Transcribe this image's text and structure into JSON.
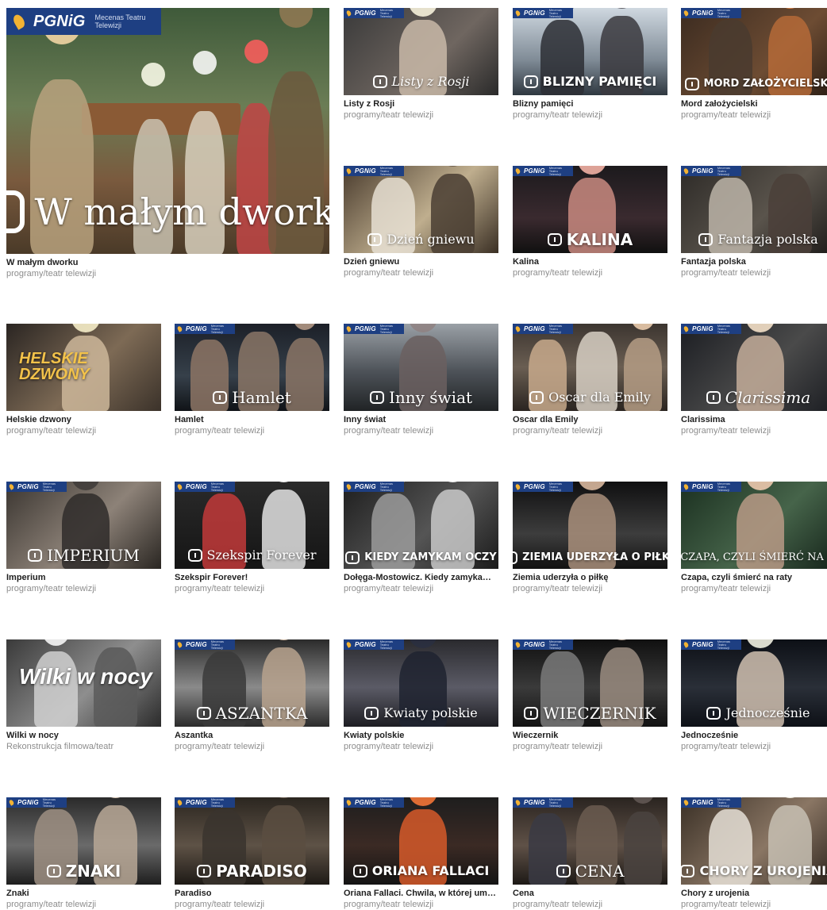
{
  "colors": {
    "title": "#1f1f1f",
    "subtitle": "#8d8d8d",
    "sponsor_band": "#1e3f82",
    "sponsor_flame": "#f2b233"
  },
  "sponsor": {
    "brand": "PGNiG",
    "mecenas": "Mecenas Teatru Telewizji"
  },
  "featured": {
    "title": "W małym dworku",
    "subtitle": "programy/teatr telewizji",
    "overlay": "W małym dworku"
  },
  "tiles": [
    {
      "title": "Listy z Rosji",
      "subtitle": "programy/teatr telewizji",
      "overlay": "Listy z Rosji"
    },
    {
      "title": "Blizny pamięci",
      "subtitle": "programy/teatr telewizji",
      "overlay": "BLIZNY PAMIĘCI"
    },
    {
      "title": "Mord założycielski",
      "subtitle": "programy/teatr telewizji",
      "overlay": "MORD ZAŁOŻYCIELSKI"
    },
    {
      "title": "Dzień gniewu",
      "subtitle": "programy/teatr telewizji",
      "overlay": "Dzień gniewu"
    },
    {
      "title": "Kalina",
      "subtitle": "programy/teatr telewizji",
      "overlay": "KALINA"
    },
    {
      "title": "Fantazja polska",
      "subtitle": "programy/teatr telewizji",
      "overlay": "Fantazja polska"
    },
    {
      "title": "Helskie dzwony",
      "subtitle": "programy/teatr telewizji",
      "overlay": "HELSKIE DZWONY"
    },
    {
      "title": "Hamlet",
      "subtitle": "programy/teatr telewizji",
      "overlay": "Hamlet"
    },
    {
      "title": "Inny świat",
      "subtitle": "programy/teatr telewizji",
      "overlay": "Inny świat"
    },
    {
      "title": "Oscar dla Emily",
      "subtitle": "programy/teatr telewizji",
      "overlay": "Oscar dla Emily"
    },
    {
      "title": "Clarissima",
      "subtitle": "programy/teatr telewizji",
      "overlay": "Clarissima"
    },
    {
      "title": "Imperium",
      "subtitle": "programy/teatr telewizji",
      "overlay": "IMPERIUM"
    },
    {
      "title": "Szekspir Forever!",
      "subtitle": "programy/teatr telewizji",
      "overlay": "Szekspir Forever"
    },
    {
      "title": "Dołęga-Mostowicz. Kiedy zamyka…",
      "subtitle": "programy/teatr telewizji",
      "overlay": "KIEDY ZAMYKAM OCZY"
    },
    {
      "title": "Ziemia uderzyła o piłkę",
      "subtitle": "programy/teatr telewizji",
      "overlay": "ZIEMIA UDERZYŁA O PIŁKĘ"
    },
    {
      "title": "Czapa, czyli śmierć na raty",
      "subtitle": "programy/teatr telewizji",
      "overlay": "CZAPA, CZYLI ŚMIERĆ NA RATY"
    },
    {
      "title": "Wilki w nocy",
      "subtitle": "Rekonstrukcja filmowa/teatr",
      "overlay": "Wilki w nocy"
    },
    {
      "title": "Aszantka",
      "subtitle": "programy/teatr telewizji",
      "overlay": "ASZANTKA"
    },
    {
      "title": "Kwiaty polskie",
      "subtitle": "programy/teatr telewizji",
      "overlay": "Kwiaty polskie"
    },
    {
      "title": "Wieczernik",
      "subtitle": "programy/teatr telewizji",
      "overlay": "WIECZERNIK"
    },
    {
      "title": "Jednocześnie",
      "subtitle": "programy/teatr telewizji",
      "overlay": "Jednocześnie"
    },
    {
      "title": "Znaki",
      "subtitle": "programy/teatr telewizji",
      "overlay": "ZNAKI"
    },
    {
      "title": "Paradiso",
      "subtitle": "programy/teatr telewizji",
      "overlay": "PARADISO"
    },
    {
      "title": "Oriana Fallaci. Chwila, w której um…",
      "subtitle": "programy/teatr telewizji",
      "overlay": "ORIANA FALLACI"
    },
    {
      "title": "Cena",
      "subtitle": "programy/teatr telewizji",
      "overlay": "CENA"
    },
    {
      "title": "Chory z urojenia",
      "subtitle": "programy/teatr telewizji",
      "overlay": "CHORY Z UROJENIA"
    }
  ]
}
